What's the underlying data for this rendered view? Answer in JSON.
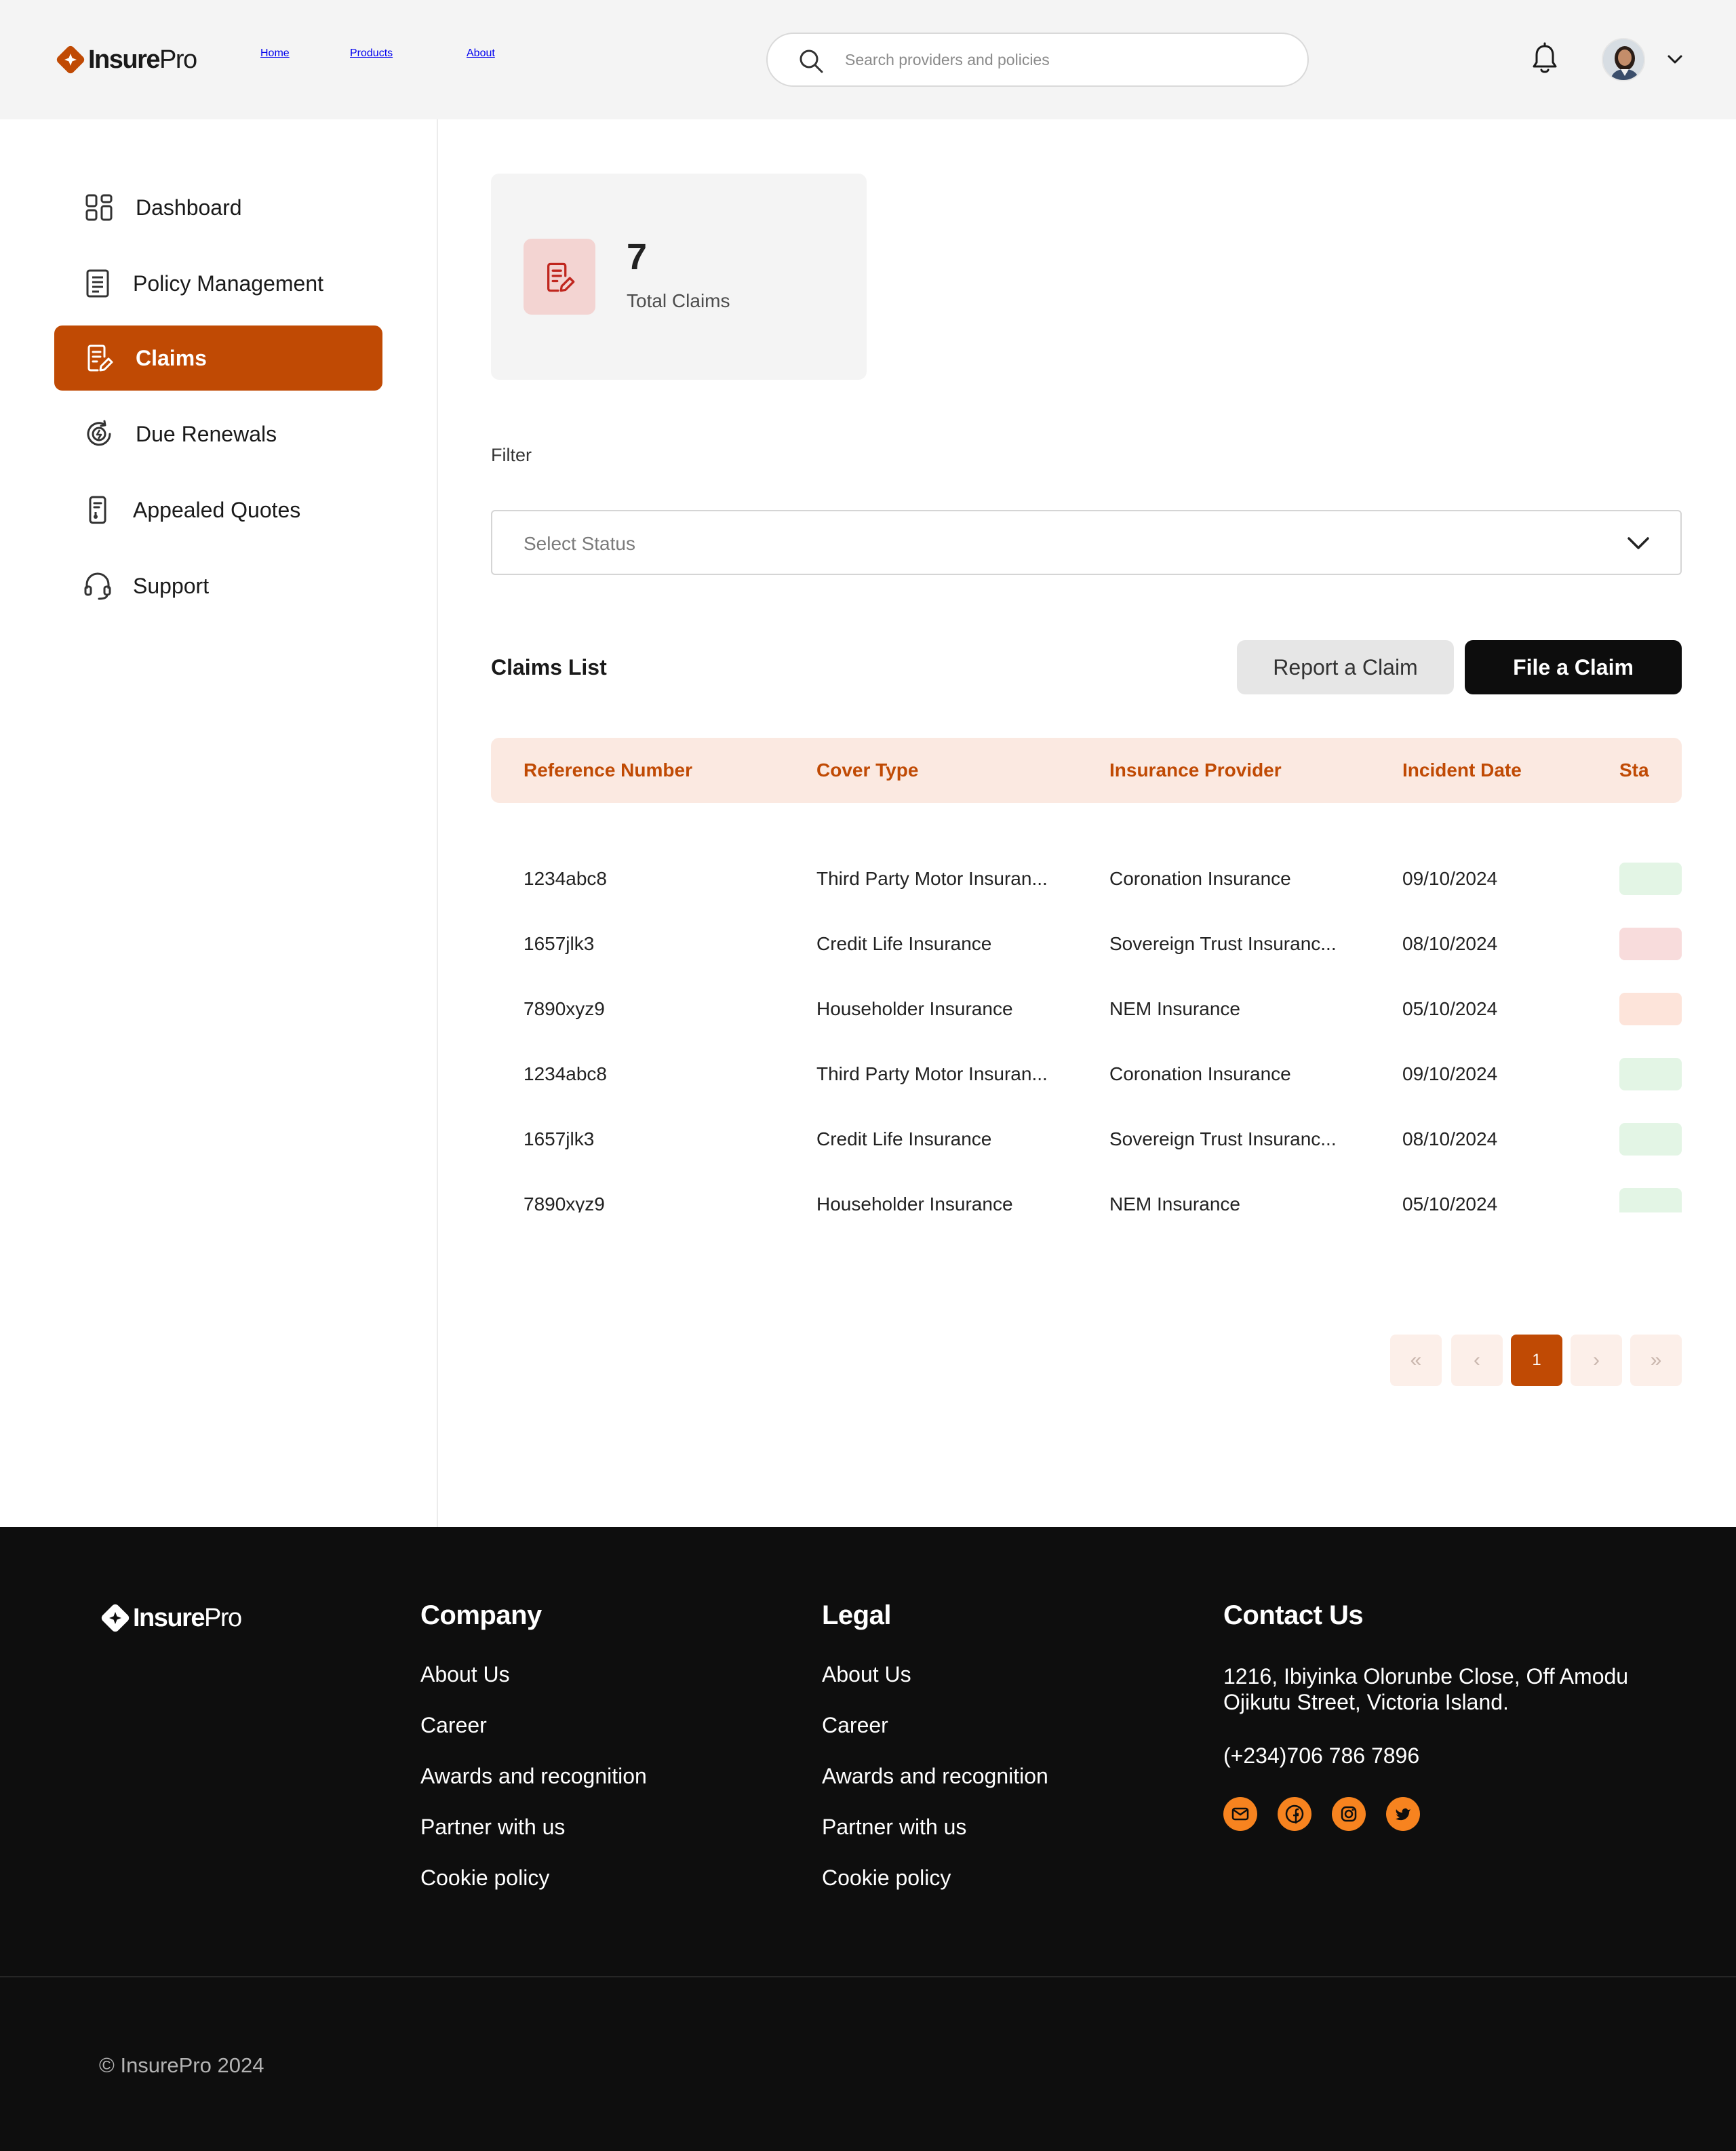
{
  "header": {
    "brand_bold": "Insure",
    "brand_light": "Pro",
    "nav": [
      "Home",
      "Products",
      "About"
    ],
    "search_placeholder": "Search providers and policies"
  },
  "sidebar": {
    "items": [
      {
        "label": "Dashboard",
        "icon": "grid-icon"
      },
      {
        "label": "Policy Management",
        "icon": "document-list-icon"
      },
      {
        "label": "Claims",
        "icon": "edit-document-icon",
        "active": true
      },
      {
        "label": "Due Renewals",
        "icon": "renewal-clock-icon"
      },
      {
        "label": "Appealed Quotes",
        "icon": "quote-phone-icon"
      },
      {
        "label": "Support",
        "icon": "headset-icon"
      }
    ]
  },
  "summary": {
    "total": "7",
    "label": "Total Claims"
  },
  "filter": {
    "label": "Filter",
    "placeholder": "Select Status"
  },
  "claims": {
    "title": "Claims List",
    "report_button": "Report a Claim",
    "file_button": "File a Claim",
    "columns": [
      "Reference Number",
      "Cover Type",
      "Insurance Provider",
      "Incident Date",
      "Sta"
    ],
    "rows": [
      {
        "ref": "1234abc8",
        "cover": "Third Party Motor Insuran...",
        "provider": "Coronation Insurance",
        "date": "09/10/2024",
        "status_color": "#e3f5e5"
      },
      {
        "ref": "1657jlk3",
        "cover": "Credit Life Insurance",
        "provider": "Sovereign Trust Insuranc...",
        "date": "08/10/2024",
        "status_color": "#f8dcdc"
      },
      {
        "ref": "7890xyz9",
        "cover": "Householder Insurance",
        "provider": "NEM Insurance",
        "date": "05/10/2024",
        "status_color": "#fde4da"
      },
      {
        "ref": "1234abc8",
        "cover": "Third Party Motor Insuran...",
        "provider": "Coronation Insurance",
        "date": "09/10/2024",
        "status_color": "#e3f5e5"
      },
      {
        "ref": "1657jlk3",
        "cover": "Credit Life Insurance",
        "provider": "Sovereign Trust Insuranc...",
        "date": "08/10/2024",
        "status_color": "#e3f5e5"
      },
      {
        "ref": "7890xyz9",
        "cover": "Householder Insurance",
        "provider": "NEM Insurance",
        "date": "05/10/2024",
        "status_color": "#e3f5e5"
      }
    ]
  },
  "pagination": {
    "first": "«",
    "prev": "‹",
    "current": "1",
    "next": "›",
    "last": "»"
  },
  "footer": {
    "company": {
      "title": "Company",
      "links": [
        "About Us",
        "Career",
        "Awards and recognition",
        "Partner with us",
        "Cookie policy"
      ]
    },
    "legal": {
      "title": "Legal",
      "links": [
        "About Us",
        "Career",
        "Awards and recognition",
        "Partner with us",
        "Cookie policy"
      ]
    },
    "contact": {
      "title": "Contact Us",
      "address": "1216, Ibiyinka Olorunbe Close, Off Amodu Ojikutu Street, Victoria Island.",
      "phone": "(+234)706 786 7896",
      "socials": [
        "mail-icon",
        "facebook-icon",
        "instagram-icon",
        "twitter-icon"
      ]
    },
    "copyright": "© InsurePro 2024"
  },
  "colors": {
    "accent": "#c04a04",
    "footer_bg": "#0e0e0e",
    "social": "#f7831f"
  }
}
